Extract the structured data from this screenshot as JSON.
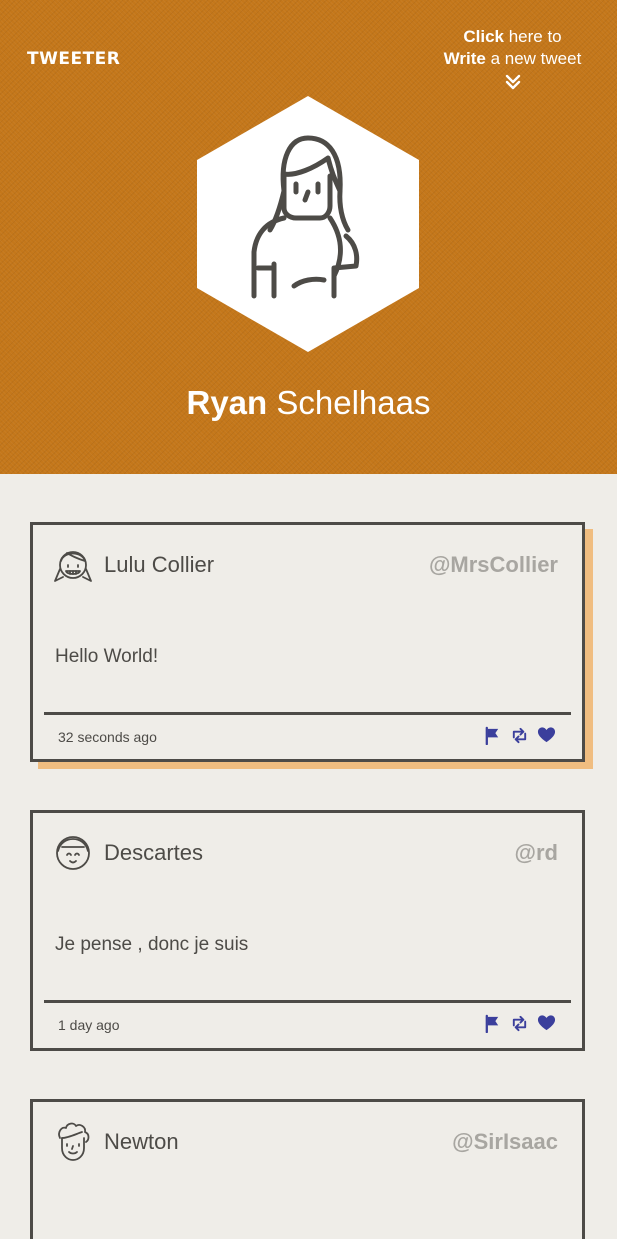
{
  "app": {
    "brand": "TWEETER"
  },
  "compose": {
    "strong1": "Click",
    "text1": " here to",
    "strong2": "Write",
    "text2": " a new tweet"
  },
  "profile": {
    "first_name": "Ryan",
    "last_name": " Schelhaas"
  },
  "tweets": [
    {
      "author": "Lulu Collier",
      "handle": "@MrsCollier",
      "text": "Hello World!",
      "time": "32 seconds ago"
    },
    {
      "author": "Descartes",
      "handle": "@rd",
      "text": "Je pense , donc je suis",
      "time": "1 day ago"
    },
    {
      "author": "Newton",
      "handle": "@SirIsaac"
    }
  ],
  "colors": {
    "header_bg": "#c4771a",
    "page_bg": "#efede8",
    "accent": "#3b3f9c",
    "shadow": "#f0bd80"
  },
  "icons": [
    "chevrons-down-icon",
    "flag-icon",
    "retweet-icon",
    "heart-icon"
  ]
}
